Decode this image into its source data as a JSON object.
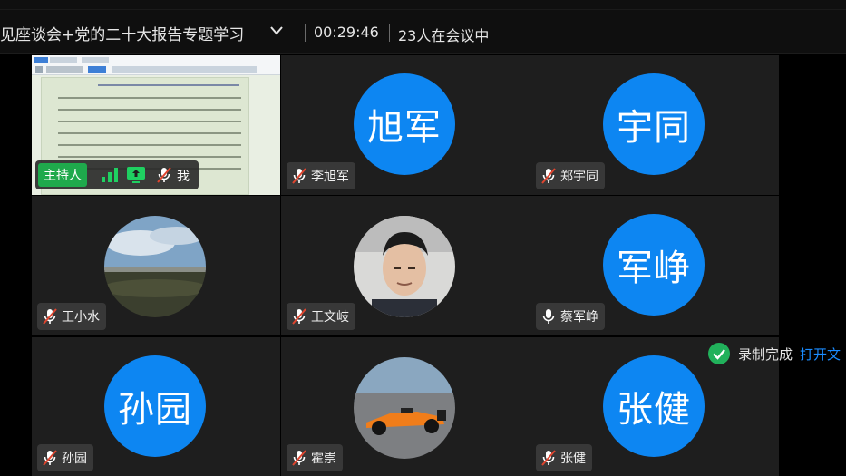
{
  "header": {
    "meeting_title": "见座谈会+党的二十大报告专题学习",
    "timer": "00:29:46",
    "participant_count": "23人在会议中"
  },
  "host_tile": {
    "host_badge": "主持人",
    "name": "我"
  },
  "participants": [
    {
      "avatar_text": "旭军",
      "name": "李旭军",
      "mic": "muted"
    },
    {
      "avatar_text": "宇同",
      "name": "郑宇同",
      "mic": "muted"
    },
    {
      "avatar_text": "",
      "name": "王小水",
      "mic": "muted"
    },
    {
      "avatar_text": "",
      "name": "王文岐",
      "mic": "muted"
    },
    {
      "avatar_text": "军峥",
      "name": "蔡军峥",
      "mic": "on"
    },
    {
      "avatar_text": "孙园",
      "name": "孙园",
      "mic": "muted"
    },
    {
      "avatar_text": "",
      "name": "霍崇",
      "mic": "muted"
    },
    {
      "avatar_text": "张健",
      "name": "张健",
      "mic": "muted"
    }
  ],
  "toast": {
    "text": "录制完成",
    "link": "打开文"
  },
  "colors": {
    "avatar_blue": "#0d86f2",
    "host_green": "#1fa94c",
    "link_blue": "#1a8cff",
    "muted_red": "#e0452f",
    "success_green": "#21b15b"
  },
  "icons": [
    "chevron-down-icon",
    "mic-muted-icon",
    "mic-icon",
    "signal-icon",
    "screen-share-icon",
    "check-circle-icon"
  ]
}
